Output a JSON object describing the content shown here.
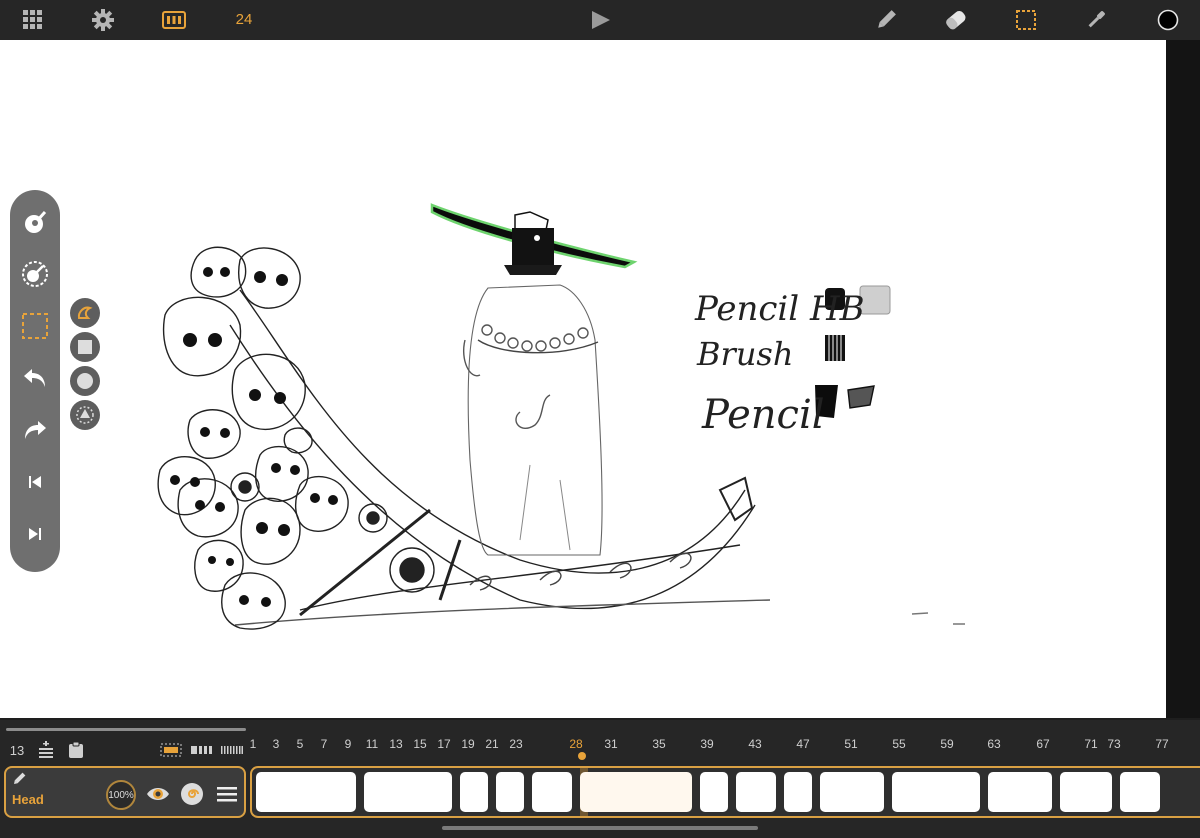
{
  "topbar": {
    "fps": "24",
    "icons": [
      "gallery-grid-icon",
      "settings-gear-icon",
      "frames-filmstrip-icon",
      "play-icon",
      "pencil-tool-icon",
      "eraser-tool-icon",
      "selection-tool-icon",
      "eyedropper-tool-icon",
      "color-swatch"
    ],
    "current_color": "#000000"
  },
  "canvas": {
    "sample_labels": [
      "Pencil HB",
      "Brush",
      "Pencil"
    ]
  },
  "toolbar": {
    "items": [
      "brush-size-icon",
      "opacity-dial-icon",
      "lasso-select-icon",
      "undo-icon",
      "redo-icon",
      "previous-frame-icon",
      "next-frame-icon"
    ],
    "select_options": [
      "freehand-lasso-icon",
      "rect-select-icon",
      "ellipse-select-icon",
      "transform-select-icon"
    ]
  },
  "timeline": {
    "start_frame": "13",
    "frame_numbers": [
      "1",
      "3",
      "5",
      "7",
      "9",
      "11",
      "13",
      "15",
      "17",
      "19",
      "21",
      "23",
      "28",
      "31",
      "35",
      "39",
      "43",
      "47",
      "51",
      "55",
      "59",
      "63",
      "67",
      "71",
      "73",
      "77"
    ],
    "current_frame": "28",
    "layer": {
      "name": "Head",
      "opacity": "100%"
    }
  },
  "colors": {
    "accent": "#e8a33a",
    "bar": "#262626",
    "toolbar": "#6f6f6f"
  }
}
